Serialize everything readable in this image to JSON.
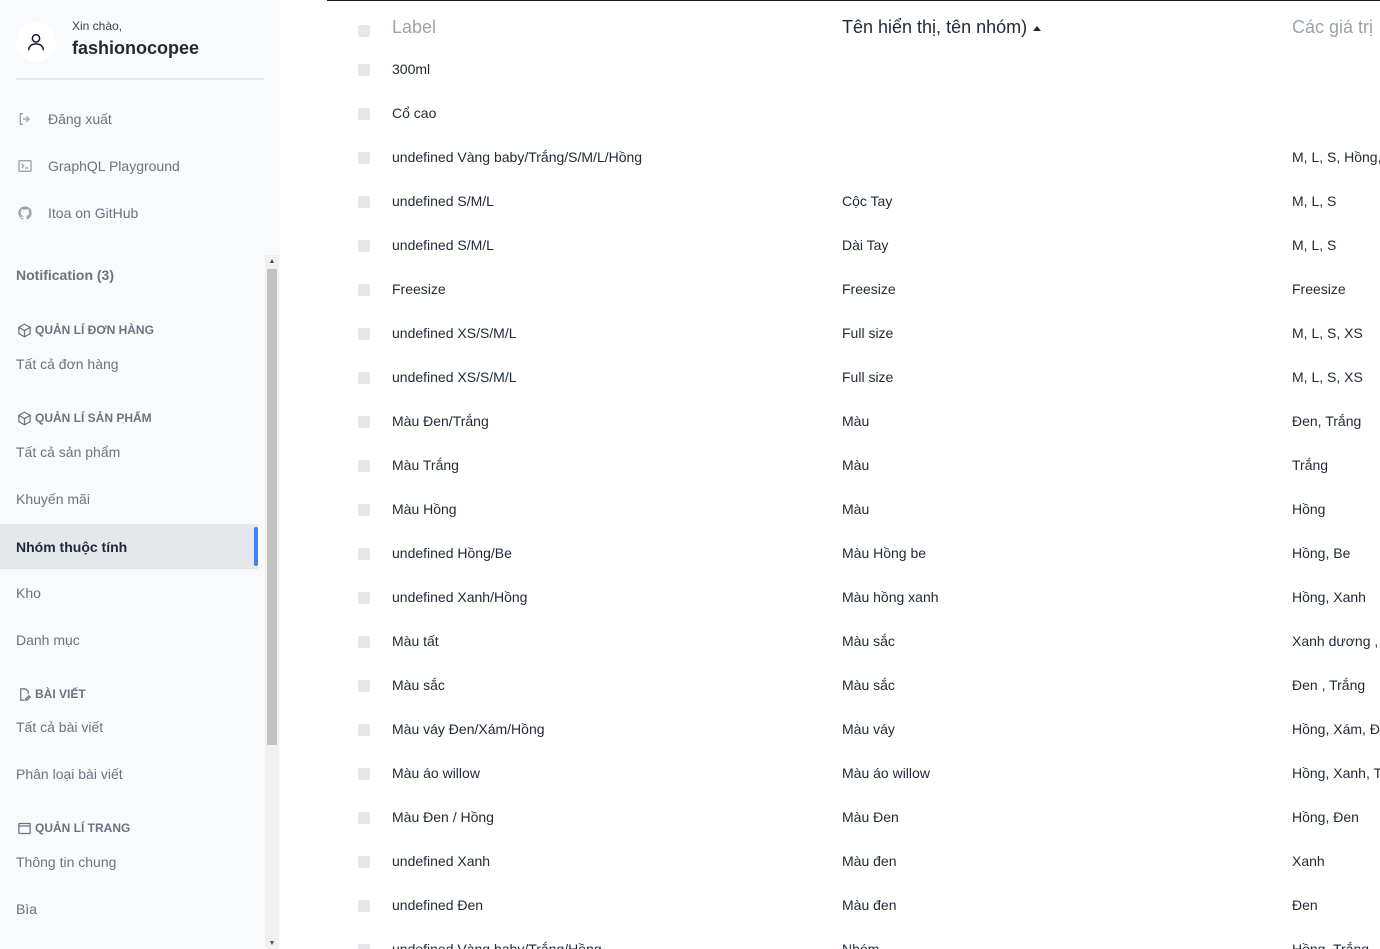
{
  "user": {
    "greeting": "Xin chào,",
    "name": "fashionocopee"
  },
  "links": [
    {
      "label": "Đăng xuất",
      "icon": "logout-icon"
    },
    {
      "label": "GraphQL Playground",
      "icon": "terminal-icon"
    },
    {
      "label": "Itoa on GitHub",
      "icon": "github-icon"
    }
  ],
  "notification": "Notification (3)",
  "sections": {
    "orders": {
      "title": "QUẢN LÍ ĐƠN HÀNG",
      "items": [
        "Tất cả đơn hàng"
      ]
    },
    "products": {
      "title": "QUẢN LÍ SẢN PHẨM",
      "items": [
        "Tất cả sản phẩm",
        "Khuyến mãi",
        "Nhóm thuộc tính",
        "Kho",
        "Danh mục"
      ]
    },
    "posts": {
      "title": "BÀI VIẾT",
      "items": [
        "Tất cả bài viết",
        "Phân loại bài viết"
      ]
    },
    "pages": {
      "title": "QUẢN LÍ TRANG",
      "items": [
        "Thông tin chung",
        "Bìa"
      ]
    }
  },
  "active_item": "Nhóm thuộc tính",
  "table": {
    "headers": [
      "Label",
      "Tên hiển thị, tên nhóm)",
      "Các giá trị"
    ],
    "rows": [
      [
        "300ml",
        "",
        ""
      ],
      [
        "Cổ cao",
        "",
        ""
      ],
      [
        "undefined Vàng baby/Trắng/S/M/L/Hồng",
        "",
        "M, L, S, Hồng,"
      ],
      [
        "undefined S/M/L",
        "Cộc Tay",
        "M, L, S"
      ],
      [
        "undefined S/M/L",
        "Dài Tay",
        "M, L, S"
      ],
      [
        "Freesize",
        "Freesize",
        "Freesize"
      ],
      [
        "undefined XS/S/M/L",
        "Full size",
        "M, L, S, XS"
      ],
      [
        "undefined XS/S/M/L",
        "Full size",
        "M, L, S, XS"
      ],
      [
        "Màu Đen/Trắng",
        "Màu",
        "Đen, Trắng"
      ],
      [
        "Màu Trắng",
        "Màu",
        "Trắng"
      ],
      [
        "Màu Hồng",
        "Màu",
        "Hồng"
      ],
      [
        "undefined Hồng/Be",
        "Màu Hồng be",
        "Hồng, Be"
      ],
      [
        "undefined Xanh/Hồng",
        "Màu hồng xanh",
        "Hồng, Xanh"
      ],
      [
        "Màu tất",
        "Màu sắc",
        "Xanh dương ,"
      ],
      [
        "Màu sắc",
        "Màu sắc",
        "Đen , Trắng"
      ],
      [
        "Màu váy Đen/Xám/Hồng",
        "Màu váy",
        "Hồng, Xám, Đ"
      ],
      [
        "Màu áo willow",
        "Màu áo willow",
        "Hồng, Xanh, T"
      ],
      [
        "Màu Đen / Hồng",
        "Màu Đen",
        "Hồng, Đen"
      ],
      [
        "undefined Xanh",
        "Màu đen",
        "Xanh"
      ],
      [
        "undefined Đen",
        "Màu đen",
        "Đen"
      ],
      [
        "undefined Vàng baby/Trắng/Hồng",
        "Nhóm",
        "Hồng, Trắng,"
      ]
    ]
  }
}
